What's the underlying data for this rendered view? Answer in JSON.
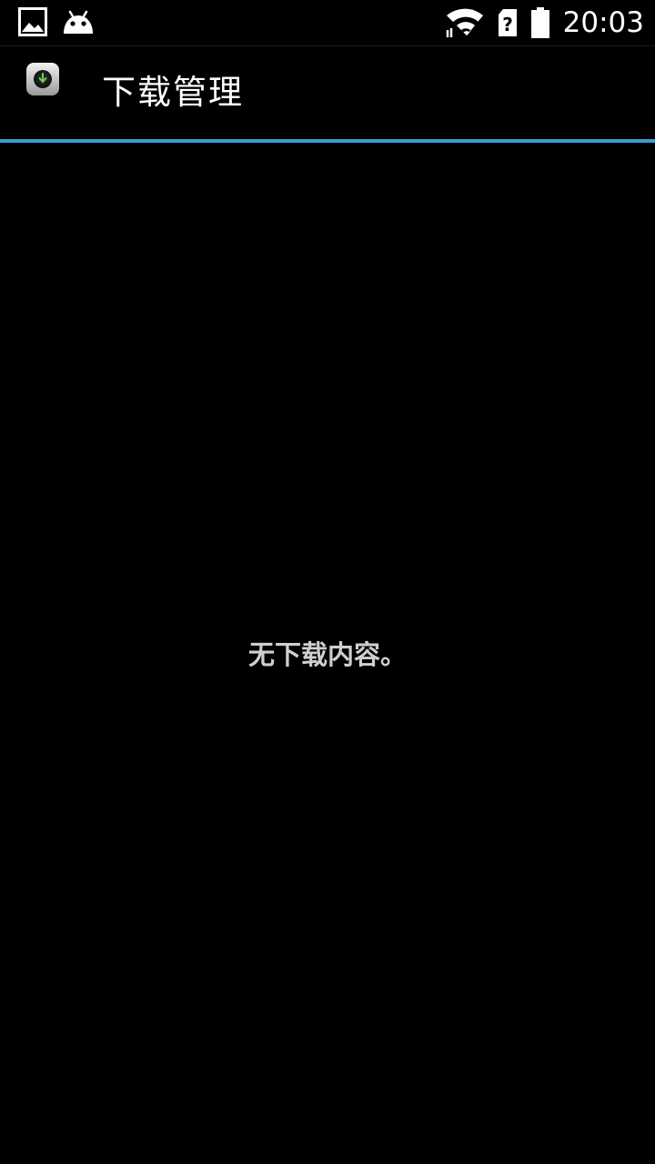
{
  "status_bar": {
    "time": "20:03",
    "icons": [
      "image-notification-icon",
      "android-notification-icon",
      "wifi-icon",
      "sim-unknown-icon",
      "battery-icon"
    ]
  },
  "action_bar": {
    "app_icon": "download-manager-icon",
    "title": "下载管理"
  },
  "content": {
    "empty_message": "无下载内容。"
  },
  "colors": {
    "background": "#000000",
    "accent_divider": "#3a9ad4",
    "title_text": "#ffffff",
    "empty_text": "#cfcfcf"
  }
}
